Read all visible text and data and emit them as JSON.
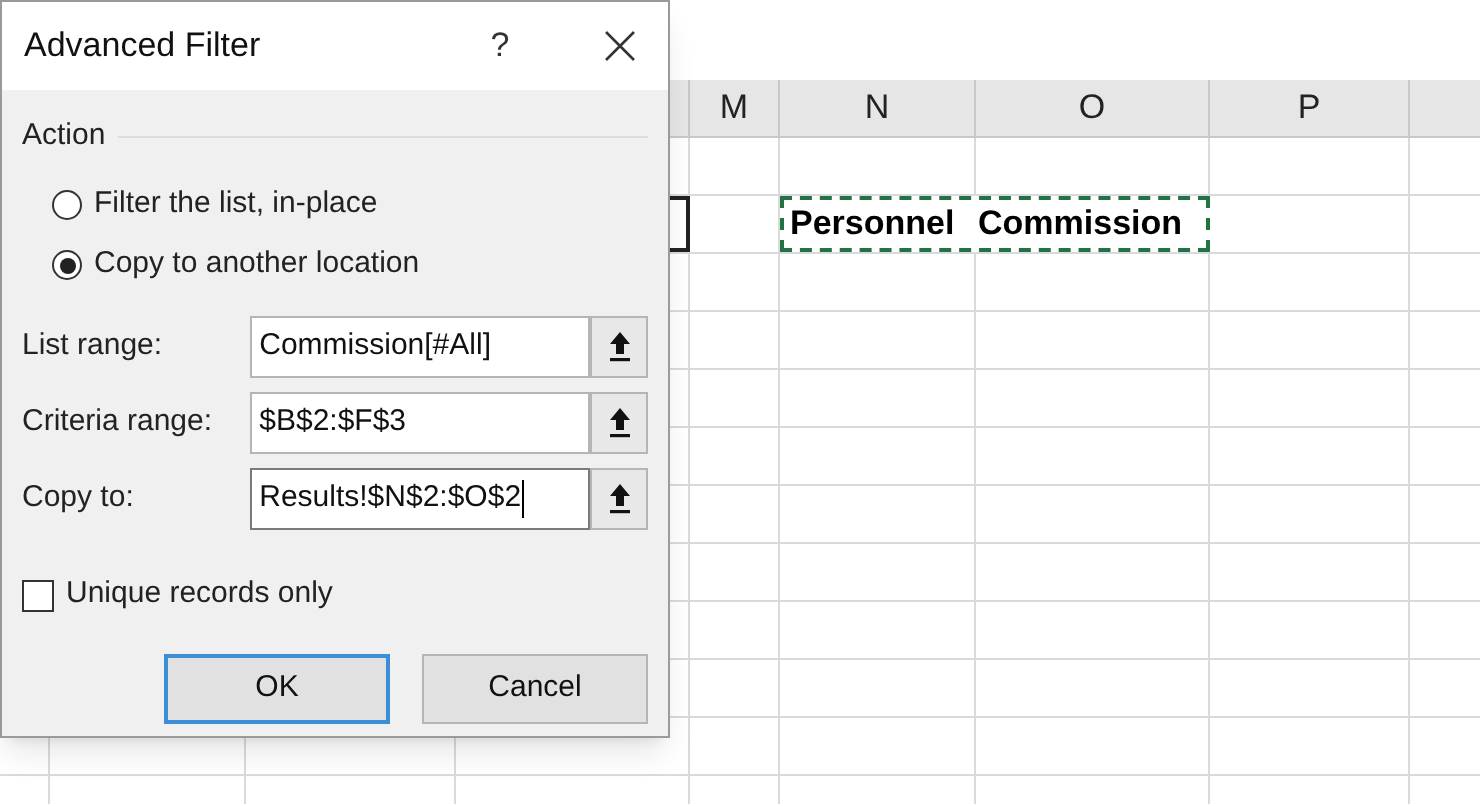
{
  "sheet": {
    "columns": [
      {
        "label": "M"
      },
      {
        "label": "N"
      },
      {
        "label": "O"
      },
      {
        "label": "P"
      }
    ],
    "copy_marquee": {
      "cells": [
        "Personnel",
        "Commission"
      ]
    }
  },
  "dialog": {
    "title": "Advanced Filter",
    "help": "?",
    "action_group": {
      "label": "Action",
      "options": [
        {
          "label": "Filter the list, in-place",
          "selected": false
        },
        {
          "label": "Copy to another location",
          "selected": true
        }
      ]
    },
    "fields": [
      {
        "label": "List range:",
        "value": "Commission[#All]",
        "focused": false
      },
      {
        "label": "Criteria range:",
        "value": "$B$2:$F$3",
        "focused": false
      },
      {
        "label": "Copy to:",
        "value": "Results!$N$2:$O$2",
        "focused": true
      }
    ],
    "checkbox": {
      "label": "Unique records only",
      "checked": false
    },
    "buttons": [
      {
        "label": "OK",
        "default": true
      },
      {
        "label": "Cancel",
        "default": false
      }
    ]
  }
}
